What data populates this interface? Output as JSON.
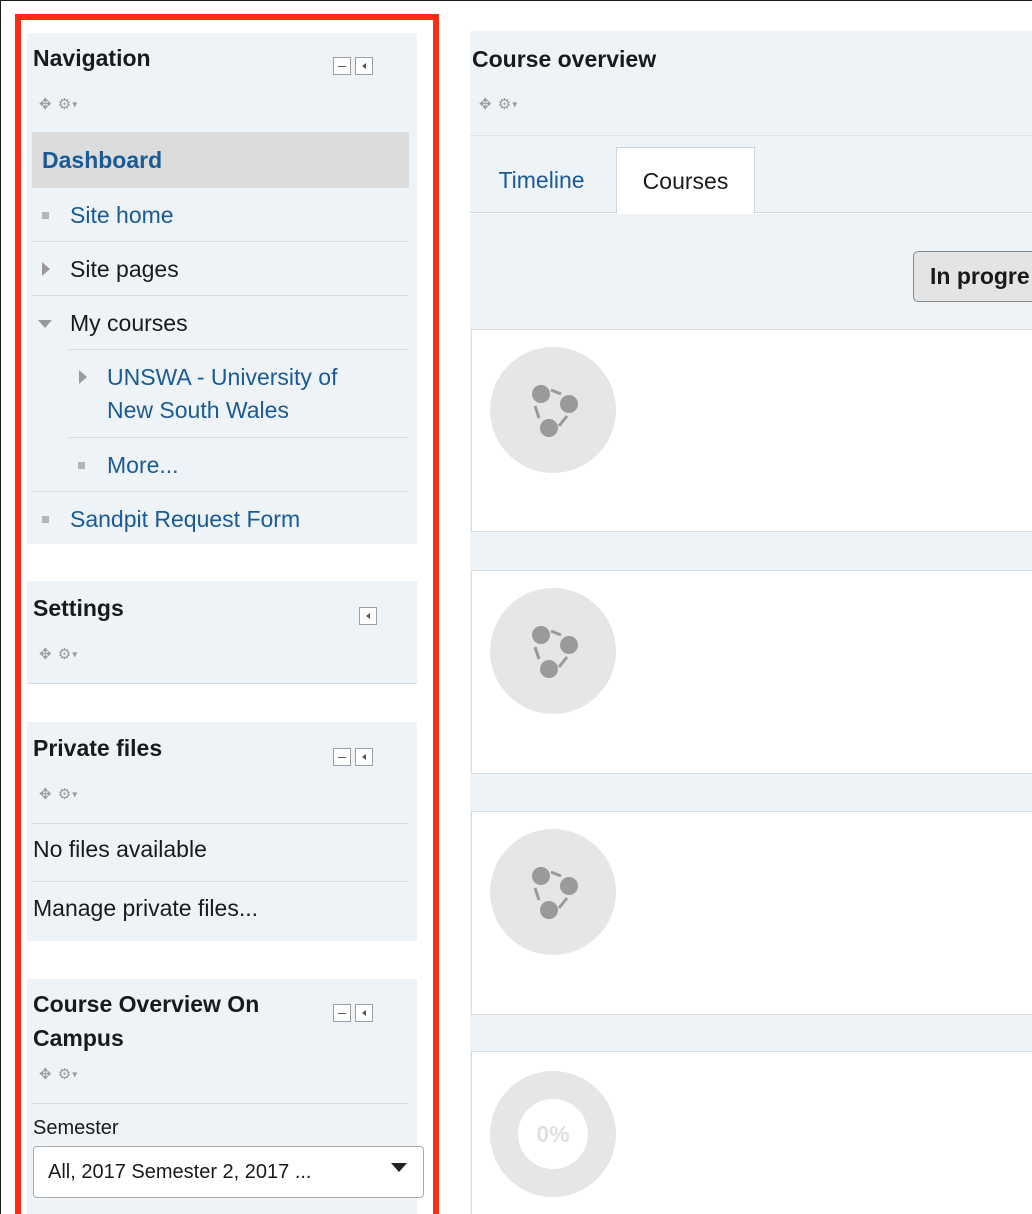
{
  "navigation": {
    "title": "Navigation",
    "dashboard": "Dashboard",
    "items": [
      {
        "label": "Site home"
      },
      {
        "label": "Site pages"
      },
      {
        "label": "My courses"
      },
      {
        "label_line1": "UNSWA - University of",
        "label_line2": "New South Wales"
      },
      {
        "label": "More..."
      },
      {
        "label": "Sandpit Request Form"
      }
    ]
  },
  "settings": {
    "title": "Settings"
  },
  "private_files": {
    "title": "Private files",
    "empty_text": "No files available",
    "manage_link": "Manage private files..."
  },
  "course_overview_block": {
    "title_line1": "Course Overview On",
    "title_line2": "Campus",
    "semester_label": "Semester",
    "semester_value": "All, 2017 Semester 2, 2017 ..."
  },
  "main": {
    "title": "Course overview",
    "tabs": [
      {
        "label": "Timeline"
      },
      {
        "label": "Courses"
      }
    ],
    "filter_button": "In progre",
    "progress_text": "0%"
  },
  "colors": {
    "highlight": "#ff2b12",
    "link": "#1a5a96",
    "block_bg": "#eef3f8"
  }
}
